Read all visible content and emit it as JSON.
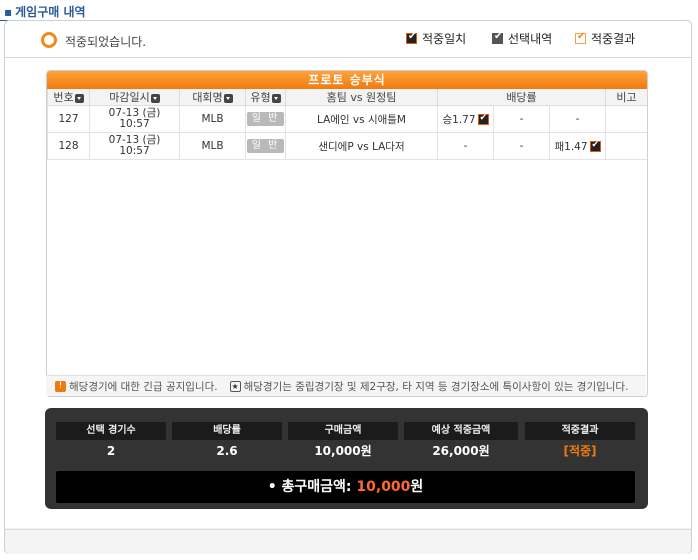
{
  "section_title": "게임구매 내역",
  "status_text": "적중되었습니다.",
  "legend": [
    {
      "label": "적중일치",
      "color": "#e05a12"
    },
    {
      "label": "선택내역",
      "color": "#555555"
    },
    {
      "label": "적중결과",
      "color": "#f0a050"
    }
  ],
  "grid": {
    "title": "프로토 승부식",
    "columns": [
      "번호",
      "마감일시",
      "대회명",
      "유형",
      "홈팀 vs 원정팀",
      "배당률",
      "비고"
    ],
    "rows": [
      {
        "no": "127",
        "date": "07-13 (금)",
        "time": "10:57",
        "league": "MLB",
        "type": "일 반",
        "match": "LA에인 vs 시애틀M",
        "odd_win": "승1.77",
        "odd_draw": "-",
        "odd_lose": "-",
        "note": ""
      },
      {
        "no": "128",
        "date": "07-13 (금)",
        "time": "10:57",
        "league": "MLB",
        "type": "일 반",
        "match": "샌디에P vs LA다저",
        "odd_win": "-",
        "odd_draw": "-",
        "odd_lose": "패1.47",
        "note": ""
      }
    ]
  },
  "notice": {
    "urgent": "해당경기에 대한 긴급 공지입니다.",
    "special": "해당경기는 중립경기장 및 제2구장, 타 지역 등 경기장소에 특이사항이 있는 경기입니다."
  },
  "summary": {
    "headers": [
      "선택 경기수",
      "배당률",
      "구매금액",
      "예상 적중금액",
      "적중결과"
    ],
    "values": [
      "2",
      "2.6",
      "10,000원",
      "26,000원",
      "[적중]"
    ],
    "total_label": "총구매금액:",
    "total_amount": "10,000",
    "total_unit": "원"
  },
  "colors": {
    "accent": "#f07a10",
    "title": "#2a5a9a",
    "summary_bg": "#333333"
  }
}
